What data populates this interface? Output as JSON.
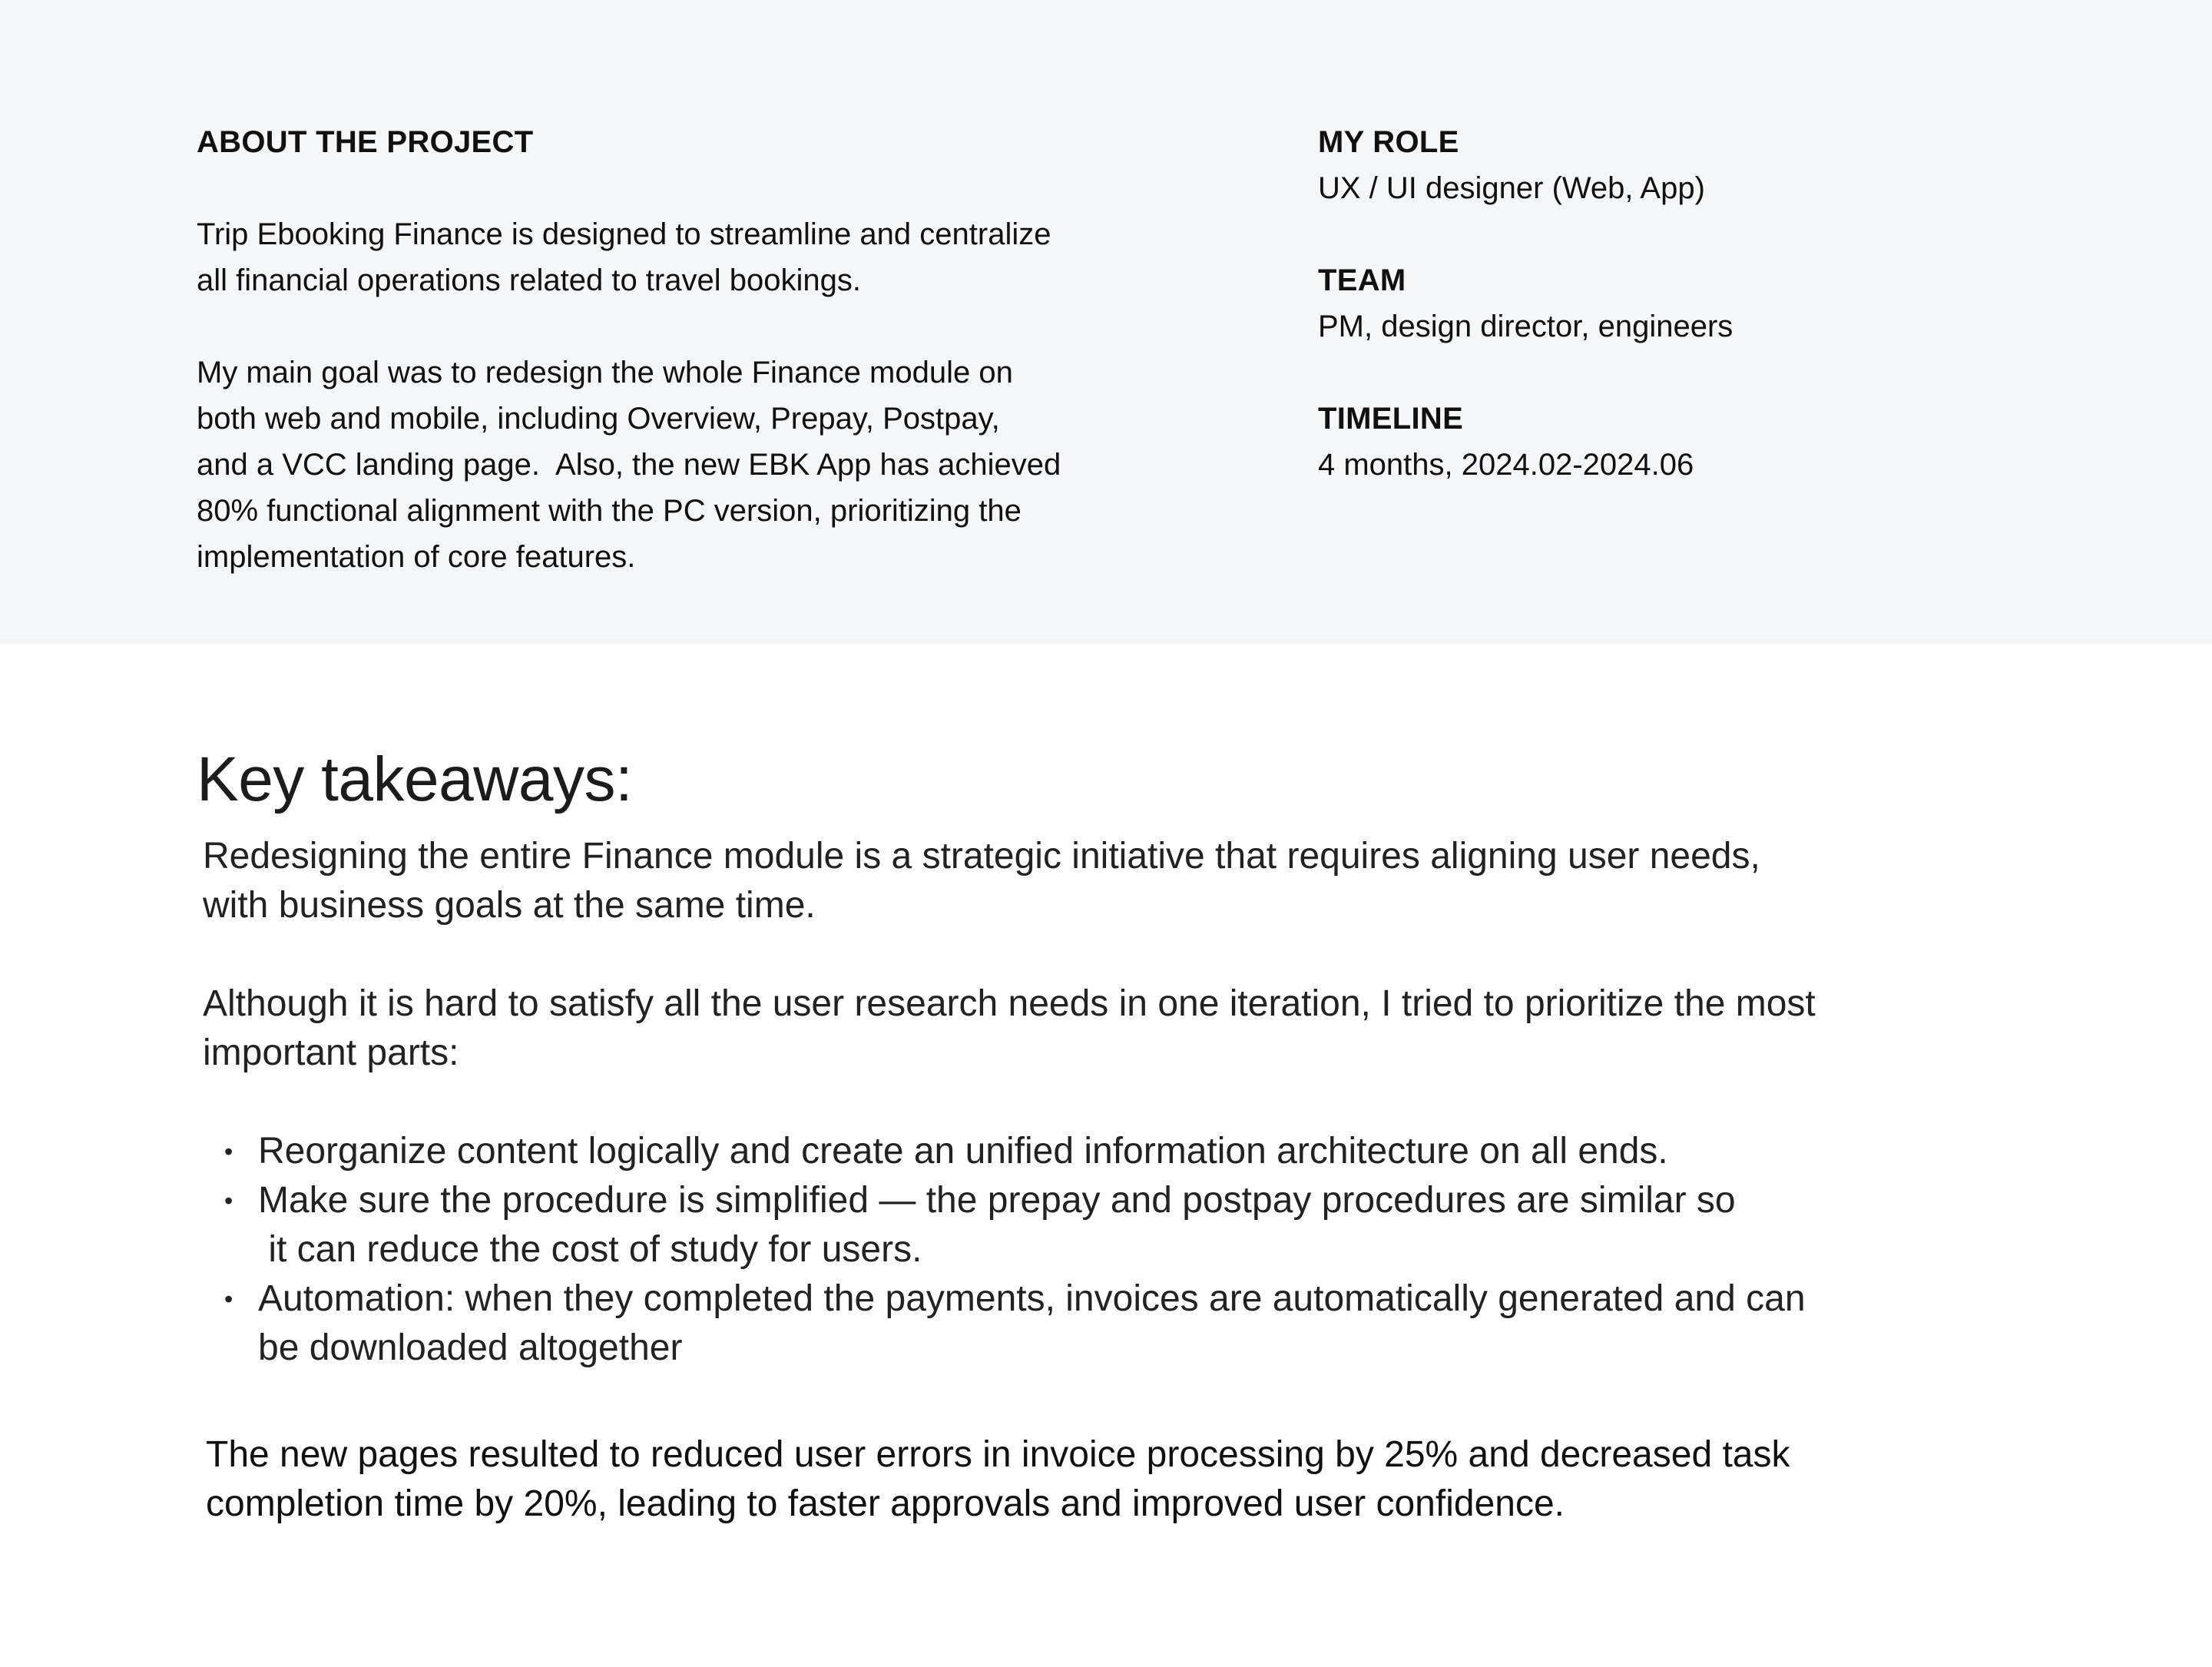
{
  "about": {
    "heading": "ABOUT THE PROJECT",
    "paragraph1_line1": "Trip Ebooking Finance is designed to streamline and centralize",
    "paragraph1_line2": "all financial operations related to travel bookings.",
    "paragraph2_line1": "My main goal was to redesign the whole Finance module on",
    "paragraph2_line2": "both web and mobile, including Overview, Prepay, Postpay,",
    "paragraph2_line3": "and a VCC landing page.  Also, the new EBK App has achieved",
    "paragraph2_line4": "80% functional alignment with the PC version, prioritizing the",
    "paragraph2_line5": "implementation of core features."
  },
  "meta": {
    "role_heading": "MY ROLE",
    "role_value": "UX / UI designer (Web, App)",
    "team_heading": "TEAM",
    "team_value": "PM, design director, engineers",
    "timeline_heading": "TIMELINE",
    "timeline_value": "4 months, 2024.02-2024.06"
  },
  "takeaways": {
    "title": "Key takeaways:",
    "intro_line1": "Redesigning the entire Finance module is a strategic initiative that requires aligning user needs,",
    "intro_line2": "with business goals at the same time.",
    "priority_line1": "Although it is hard to satisfy all the user research needs in one iteration, I tried to prioritize the most",
    "priority_line2": "important parts:",
    "bullet_symbol": "•",
    "bullets": [
      {
        "line1": "Reorganize content logically and create an unified information architecture on all ends.",
        "line2": ""
      },
      {
        "line1": "Make sure the procedure is simplified — the prepay and postpay procedures are similar so",
        "line2": " it can reduce the cost of study for users."
      },
      {
        "line1": "Automation: when they completed the payments, invoices are automatically generated and can",
        "line2": "be downloaded altogether"
      }
    ],
    "result_line1": "The new pages resulted to reduced user errors in invoice processing by 25% and decreased task",
    "result_line2": "completion time by 20%, leading to faster approvals and improved user confidence."
  },
  "colors": {
    "top_band_background": "#f5f6f8",
    "text": "#1a1a1a"
  }
}
